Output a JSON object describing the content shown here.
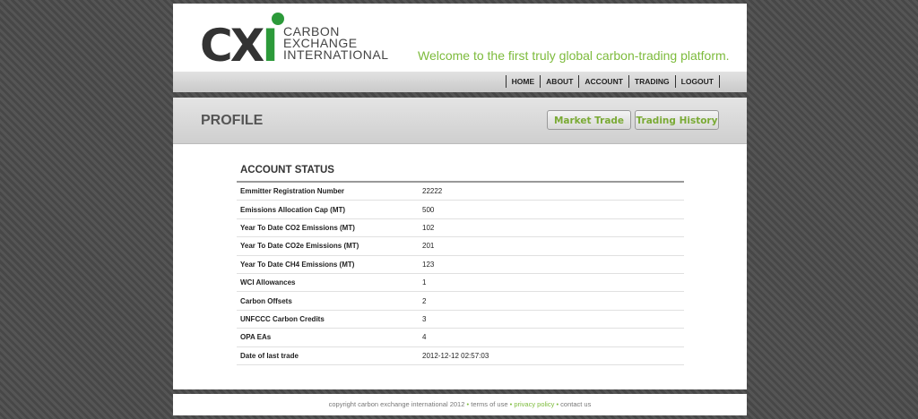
{
  "logo": {
    "mark": "CX",
    "mark_i": "I",
    "line1": "CARBON",
    "line2": "EXCHANGE",
    "line3": "INTERNATIONAL"
  },
  "tagline": "Welcome to the first truly global carbon-trading platform.",
  "nav": [
    "HOME",
    "ABOUT",
    "ACCOUNT",
    "TRADING",
    "LOGOUT"
  ],
  "page_title": "PROFILE",
  "buttons": {
    "market_trade": "Market Trade",
    "trading_history": "Trading History"
  },
  "account_status": {
    "title": "ACCOUNT STATUS",
    "rows": [
      {
        "label": "Emmitter Registration Number",
        "value": "22222"
      },
      {
        "label": "Emissions Allocation Cap (MT)",
        "value": "500"
      },
      {
        "label": "Year To Date CO2 Emissions (MT)",
        "value": "102"
      },
      {
        "label": "Year To Date CO2e Emissions (MT)",
        "value": "201"
      },
      {
        "label": "Year To Date CH4 Emissions (MT)",
        "value": "123"
      },
      {
        "label": "WCI Allowances",
        "value": "1"
      },
      {
        "label": "Carbon Offsets",
        "value": "2"
      },
      {
        "label": "UNFCCC Carbon Credits",
        "value": "3"
      },
      {
        "label": "OPA EAs",
        "value": "4"
      },
      {
        "label": "Date of last trade",
        "value": "2012-12-12 02:57:03"
      }
    ]
  },
  "footer": {
    "copyright": "copyright carbon exchange international 2012",
    "terms": "terms of use",
    "privacy": "privacy policy",
    "contact": "contact us",
    "separator": "•"
  },
  "colors": {
    "accent_green": "#7dbb3c",
    "logo_green": "#2c9a3a"
  }
}
